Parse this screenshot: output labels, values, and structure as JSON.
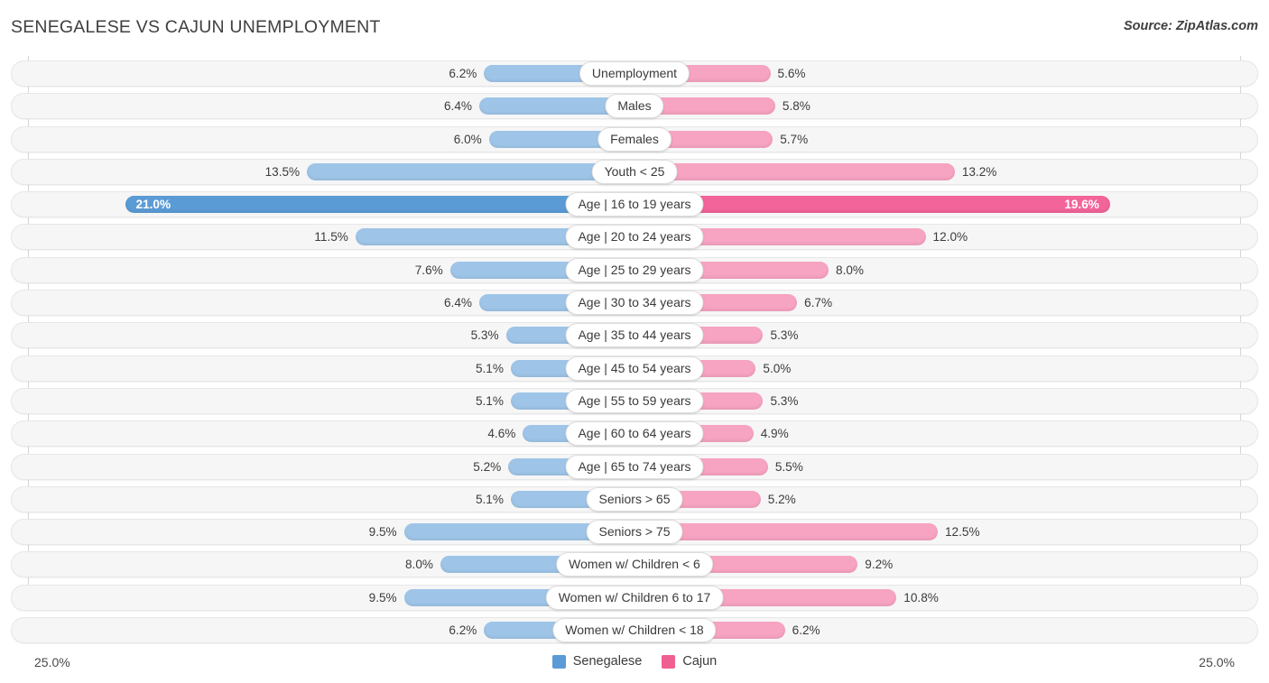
{
  "header": {
    "title": "SENEGALESE VS CAJUN UNEMPLOYMENT",
    "source": "Source: ZipAtlas.com"
  },
  "axis": {
    "left_tick": "25.0%",
    "right_tick": "25.0%",
    "max": 25.0
  },
  "legend": [
    {
      "label": "Senegalese",
      "color": "#5b9bd5"
    },
    {
      "label": "Cajun",
      "color": "#ef5f92"
    }
  ],
  "colors": {
    "blue_normal": "#9ec5e8",
    "blue_strong": "#5b9bd5",
    "pink_normal": "#f7a3c2",
    "pink_strong": "#f2649a",
    "track": "#f6f6f6",
    "track_border": "#e7e7e7"
  },
  "chart_data": {
    "type": "bar",
    "title": "SENEGALESE VS CAJUN UNEMPLOYMENT",
    "subtitle": "Source: ZipAtlas.com",
    "orientation": "horizontal-diverging",
    "xlabel": "",
    "ylabel": "",
    "xlim": [
      0,
      25.0
    ],
    "axis_ticks": [
      "25.0%",
      "25.0%"
    ],
    "grid": false,
    "legend_position": "bottom-center",
    "categories": [
      "Unemployment",
      "Males",
      "Females",
      "Youth < 25",
      "Age | 16 to 19 years",
      "Age | 20 to 24 years",
      "Age | 25 to 29 years",
      "Age | 30 to 34 years",
      "Age | 35 to 44 years",
      "Age | 45 to 54 years",
      "Age | 55 to 59 years",
      "Age | 60 to 64 years",
      "Age | 65 to 74 years",
      "Seniors > 65",
      "Seniors > 75",
      "Women w/ Children < 6",
      "Women w/ Children 6 to 17",
      "Women w/ Children < 18"
    ],
    "series": [
      {
        "name": "Senegalese",
        "values": [
          6.2,
          6.4,
          6.0,
          13.5,
          21.0,
          11.5,
          7.6,
          6.4,
          5.3,
          5.1,
          5.1,
          4.6,
          5.2,
          5.1,
          9.5,
          8.0,
          9.5,
          6.2
        ]
      },
      {
        "name": "Cajun",
        "values": [
          5.6,
          5.8,
          5.7,
          13.2,
          19.6,
          12.0,
          8.0,
          6.7,
          5.3,
          5.0,
          5.3,
          4.9,
          5.5,
          5.2,
          12.5,
          9.2,
          10.8,
          6.2
        ]
      }
    ]
  },
  "rows": [
    {
      "label": "Unemployment",
      "left_value": 6.2,
      "left_text": "6.2%",
      "right_value": 5.6,
      "right_text": "5.6%",
      "highlight": false
    },
    {
      "label": "Males",
      "left_value": 6.4,
      "left_text": "6.4%",
      "right_value": 5.8,
      "right_text": "5.8%",
      "highlight": false
    },
    {
      "label": "Females",
      "left_value": 6.0,
      "left_text": "6.0%",
      "right_value": 5.7,
      "right_text": "5.7%",
      "highlight": false
    },
    {
      "label": "Youth < 25",
      "left_value": 13.5,
      "left_text": "13.5%",
      "right_value": 13.2,
      "right_text": "13.2%",
      "highlight": false
    },
    {
      "label": "Age | 16 to 19 years",
      "left_value": 21.0,
      "left_text": "21.0%",
      "right_value": 19.6,
      "right_text": "19.6%",
      "highlight": true
    },
    {
      "label": "Age | 20 to 24 years",
      "left_value": 11.5,
      "left_text": "11.5%",
      "right_value": 12.0,
      "right_text": "12.0%",
      "highlight": false
    },
    {
      "label": "Age | 25 to 29 years",
      "left_value": 7.6,
      "left_text": "7.6%",
      "right_value": 8.0,
      "right_text": "8.0%",
      "highlight": false
    },
    {
      "label": "Age | 30 to 34 years",
      "left_value": 6.4,
      "left_text": "6.4%",
      "right_value": 6.7,
      "right_text": "6.7%",
      "highlight": false
    },
    {
      "label": "Age | 35 to 44 years",
      "left_value": 5.3,
      "left_text": "5.3%",
      "right_value": 5.3,
      "right_text": "5.3%",
      "highlight": false
    },
    {
      "label": "Age | 45 to 54 years",
      "left_value": 5.1,
      "left_text": "5.1%",
      "right_value": 5.0,
      "right_text": "5.0%",
      "highlight": false
    },
    {
      "label": "Age | 55 to 59 years",
      "left_value": 5.1,
      "left_text": "5.1%",
      "right_value": 5.3,
      "right_text": "5.3%",
      "highlight": false
    },
    {
      "label": "Age | 60 to 64 years",
      "left_value": 4.6,
      "left_text": "4.6%",
      "right_value": 4.9,
      "right_text": "4.9%",
      "highlight": false
    },
    {
      "label": "Age | 65 to 74 years",
      "left_value": 5.2,
      "left_text": "5.2%",
      "right_value": 5.5,
      "right_text": "5.5%",
      "highlight": false
    },
    {
      "label": "Seniors > 65",
      "left_value": 5.1,
      "left_text": "5.1%",
      "right_value": 5.2,
      "right_text": "5.2%",
      "highlight": false
    },
    {
      "label": "Seniors > 75",
      "left_value": 9.5,
      "left_text": "9.5%",
      "right_value": 12.5,
      "right_text": "12.5%",
      "highlight": false
    },
    {
      "label": "Women w/ Children < 6",
      "left_value": 8.0,
      "left_text": "8.0%",
      "right_value": 9.2,
      "right_text": "9.2%",
      "highlight": false
    },
    {
      "label": "Women w/ Children 6 to 17",
      "left_value": 9.5,
      "left_text": "9.5%",
      "right_value": 10.8,
      "right_text": "10.8%",
      "highlight": false
    },
    {
      "label": "Women w/ Children < 18",
      "left_value": 6.2,
      "left_text": "6.2%",
      "right_value": 6.2,
      "right_text": "6.2%",
      "highlight": false
    }
  ]
}
